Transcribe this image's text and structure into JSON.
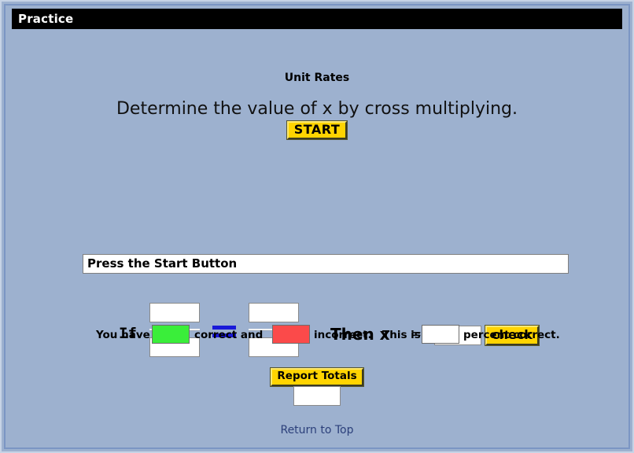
{
  "window": {
    "title": "Practice",
    "background_color": "#9db1cf",
    "frame_color": "#7b96c4"
  },
  "header": {
    "subject_title": "Unit Rates",
    "instruction": "Determine the value of x by cross multiplying.",
    "start_label": "START",
    "accent_color": "#ffd400"
  },
  "equation": {
    "if_label": "If",
    "numerator_left_value": "",
    "denominator_left_value": "",
    "numerator_right_value": "",
    "denominator_right_value": "",
    "equals_symbol_color": "#1a1ad8",
    "then_label": "Then x",
    "equals_label": "=",
    "x_value": "",
    "check_label": "check"
  },
  "message": {
    "text": "Press the Start Button"
  },
  "score": {
    "you_have_label": "You have",
    "correct_value": "",
    "correct_label": "correct and",
    "correct_color": "#3aee3a",
    "incorrect_value": "",
    "incorrect_label": "incorrect.",
    "incorrect_color": "#fb4a4a",
    "this_is_label": "This is",
    "percent_value": "",
    "percent_label": "percent correct."
  },
  "footer": {
    "report_totals_label": "Report Totals",
    "totals_value": "",
    "return_link_label": "Return to Top",
    "link_color": "#2b3f7a"
  }
}
